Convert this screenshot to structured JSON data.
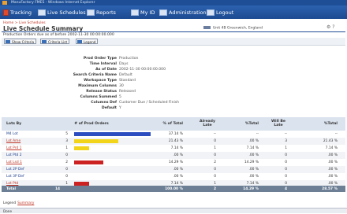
{
  "window": {
    "title": "ManuFactory FMES - Windows Internet Explorer"
  },
  "nav": {
    "items": [
      {
        "label": "Tracking",
        "name": "nav-tracking"
      },
      {
        "label": "Live Schedules",
        "name": "nav-live-schedules"
      },
      {
        "label": "Reports",
        "name": "nav-reports"
      },
      {
        "label": "My ID",
        "name": "nav-my-id"
      },
      {
        "label": "Administration",
        "name": "nav-administration"
      },
      {
        "label": "Logout",
        "name": "nav-logout"
      }
    ]
  },
  "breadcrumb": "Home > Live Schedules",
  "page": {
    "title": "Live Schedule Summary",
    "subtitle": "Production Orders due as of before 2002-11-30 00:00:00.000",
    "user_location": "Unit 4B Greenwich, England",
    "corner_icons": "⚙ ?"
  },
  "toolbar": {
    "buttons": [
      {
        "label": "Show Criteria",
        "name": "show-criteria-button"
      },
      {
        "label": "Criteria List",
        "name": "criteria-list-button"
      },
      {
        "label": "Legend",
        "name": "legend-button"
      }
    ]
  },
  "criteria": [
    {
      "label": "Prod Order Type",
      "value": "Production"
    },
    {
      "label": "Time Interval",
      "value": "Days"
    },
    {
      "label": "As of Date",
      "value": "2002-11-30 00:00:00.000"
    },
    {
      "label": "Search Criteria Name",
      "value": "Default"
    },
    {
      "label": "Workspace Type",
      "value": "Standard"
    },
    {
      "label": "Maximum Columns",
      "value": "30"
    },
    {
      "label": "Release Status",
      "value": "Released"
    },
    {
      "label": "Columns Summed",
      "value": "5"
    },
    {
      "label": "Columns Def",
      "value": "Customer Due / Scheduled Finish"
    },
    {
      "label": "Default",
      "value": "Y"
    }
  ],
  "table": {
    "headers": {
      "lot": "Lots By",
      "orders": "# of Prod Orders",
      "pct_total": "% of Total",
      "already_late": "Already Late",
      "pct_total2": "%Total",
      "will_be_late": "Will Be Late",
      "pct_total3": "%Total"
    },
    "rows": [
      {
        "lot": "M4 Lot",
        "link": false,
        "orders": "5",
        "pct": "37.14 %",
        "late": "--",
        "late_pct": "--",
        "will": "--",
        "will_pct": "--",
        "bar_fraction": 0.3714,
        "bar_color": "#2b4dbf"
      },
      {
        "lot": "Lot Ame",
        "link": true,
        "orders": "3",
        "pct": "21.43 %",
        "late": "0",
        "late_pct": ".00 %",
        "will": "3",
        "will_pct": "21.43 %",
        "bar_fraction": 0.2143,
        "bar_color": "#f2d51b"
      },
      {
        "lot": "Lot Prd 1",
        "link": true,
        "orders": "1",
        "pct": "7.14 %",
        "late": "1",
        "late_pct": "7.14 %",
        "will": "1",
        "will_pct": "7.14 %",
        "bar_fraction": 0.0714,
        "bar_color": "#f2d51b"
      },
      {
        "lot": "Lot Ptd 2",
        "link": false,
        "orders": "0",
        "pct": ".00 %",
        "late": "0",
        "late_pct": ".00 %",
        "will": "0",
        "will_pct": ".00 %",
        "bar_fraction": 0,
        "bar_color": "#cc2222"
      },
      {
        "lot": "Lot Lsd 1",
        "link": true,
        "orders": "2",
        "pct": "14.29 %",
        "late": "2",
        "late_pct": "14.29 %",
        "will": "0",
        "will_pct": ".00 %",
        "bar_fraction": 0.1429,
        "bar_color": "#cc2222"
      },
      {
        "lot": "Lot 2P Def",
        "link": false,
        "orders": "0",
        "pct": ".00 %",
        "late": "0",
        "late_pct": ".00 %",
        "will": "0",
        "will_pct": ".00 %",
        "bar_fraction": 0,
        "bar_color": "#cc2222"
      },
      {
        "lot": "Lot 3P Def",
        "link": false,
        "orders": "0",
        "pct": ".00 %",
        "late": "0",
        "late_pct": ".00 %",
        "will": "0",
        "will_pct": ".00 %",
        "bar_fraction": 0,
        "bar_color": "#cc2222"
      },
      {
        "lot": "Lot Ptd",
        "link": true,
        "orders": "1",
        "pct": "7.14 %",
        "late": "1",
        "late_pct": "7.14 %",
        "will": "0",
        "will_pct": ".00 %",
        "bar_fraction": 0.0714,
        "bar_color": "#cc2222"
      }
    ],
    "total": {
      "label": "Total",
      "orders": "14",
      "pct": "100.00 %",
      "late": "2",
      "late_pct": "14.29 %",
      "will": "4",
      "will_pct": "28.57 %"
    }
  },
  "legend_text": "Legend",
  "legend_link": "Summary",
  "status": "Done"
}
